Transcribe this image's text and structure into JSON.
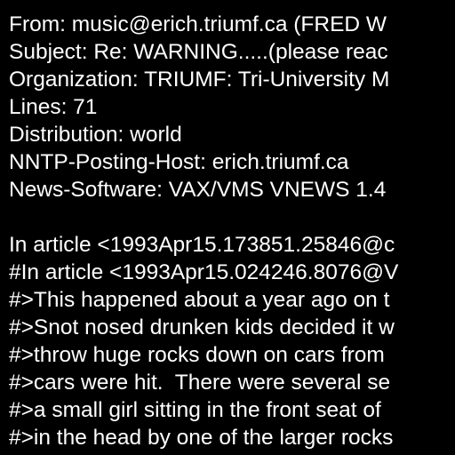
{
  "colors": {
    "background": "#000000",
    "text": "#ffffff"
  },
  "header": {
    "from": "From: music@erich.triumf.ca (FRED W",
    "subject": "Subject: Re: WARNING.....(please reac",
    "organization": "Organization: TRIUMF: Tri-University M",
    "lines": "Lines: 71",
    "distribution": "Distribution: world",
    "nntp_host": "NNTP-Posting-Host: erich.triumf.ca",
    "news_software": "News-Software: VAX/VMS VNEWS 1.4"
  },
  "body": {
    "lines": [
      "In article <1993Apr15.173851.25846@c",
      "#In article <1993Apr15.024246.8076@V",
      "#>This happened about a year ago on t",
      "#>Snot nosed drunken kids decided it w",
      "#>throw huge rocks down on cars from",
      "#>cars were hit.  There were several se",
      "#>a small girl sitting in the front seat of",
      "#>in the head by one of the larger rocks"
    ]
  }
}
